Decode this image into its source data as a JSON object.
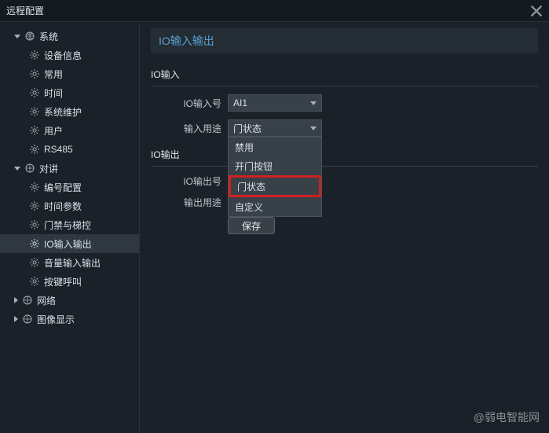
{
  "window": {
    "title": "远程配置"
  },
  "sidebar": {
    "groups": [
      {
        "label": "系统",
        "expanded": true,
        "items": [
          {
            "label": "设备信息"
          },
          {
            "label": "常用"
          },
          {
            "label": "时间"
          },
          {
            "label": "系统维护"
          },
          {
            "label": "用户"
          },
          {
            "label": "RS485"
          }
        ]
      },
      {
        "label": "对讲",
        "expanded": true,
        "items": [
          {
            "label": "编号配置"
          },
          {
            "label": "时间参数"
          },
          {
            "label": "门禁与梯控"
          },
          {
            "label": "IO输入输出",
            "active": true
          },
          {
            "label": "音量输入输出"
          },
          {
            "label": "按键呼叫"
          }
        ]
      },
      {
        "label": "网络",
        "expanded": false
      },
      {
        "label": "图像显示",
        "expanded": false
      }
    ]
  },
  "page": {
    "title": "IO输入输出",
    "sections": {
      "input": {
        "title": "IO输入",
        "fields": {
          "io_input_no": {
            "label": "IO输入号",
            "value": "AI1"
          },
          "input_usage": {
            "label": "输入用途",
            "value": "门状态",
            "options": [
              "禁用",
              "开门按钮",
              "门状态",
              "自定义"
            ],
            "highlighted": "门状态"
          }
        }
      },
      "output": {
        "title": "IO输出",
        "fields": {
          "io_output_no": {
            "label": "IO输出号"
          },
          "output_usage": {
            "label": "输出用途"
          }
        }
      }
    },
    "save_button": "保存"
  },
  "watermark": "@弱电智能网"
}
